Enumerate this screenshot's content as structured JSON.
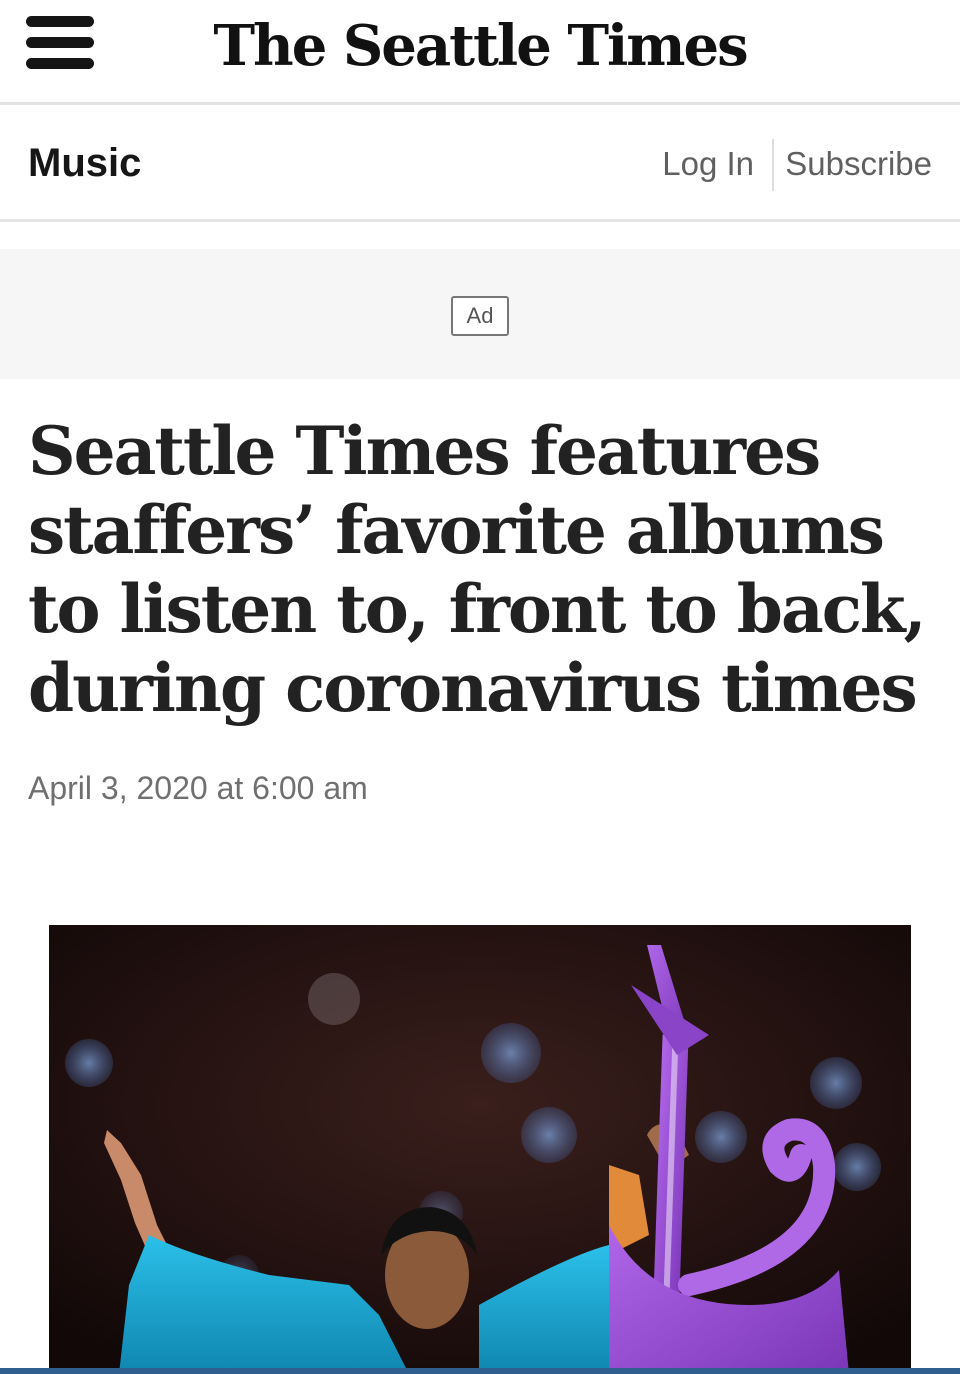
{
  "masthead": {
    "logo_text": "The Seattle Times"
  },
  "section": {
    "name": "Music",
    "login_label": "Log In",
    "subscribe_label": "Subscribe"
  },
  "ad": {
    "label": "Ad"
  },
  "article": {
    "headline": "Seattle Times features staffers’ favorite albums to listen to, front to back, during coronavirus times",
    "dateline": "April 3, 2020 at 6:00 am"
  },
  "icons": {
    "menu": "hamburger-menu-icon"
  },
  "colors": {
    "text": "#222222",
    "muted": "#707070",
    "ad_bg": "#f6f6f6",
    "guitar": "#9b4fd6",
    "jacket": "#1aa3c9"
  }
}
